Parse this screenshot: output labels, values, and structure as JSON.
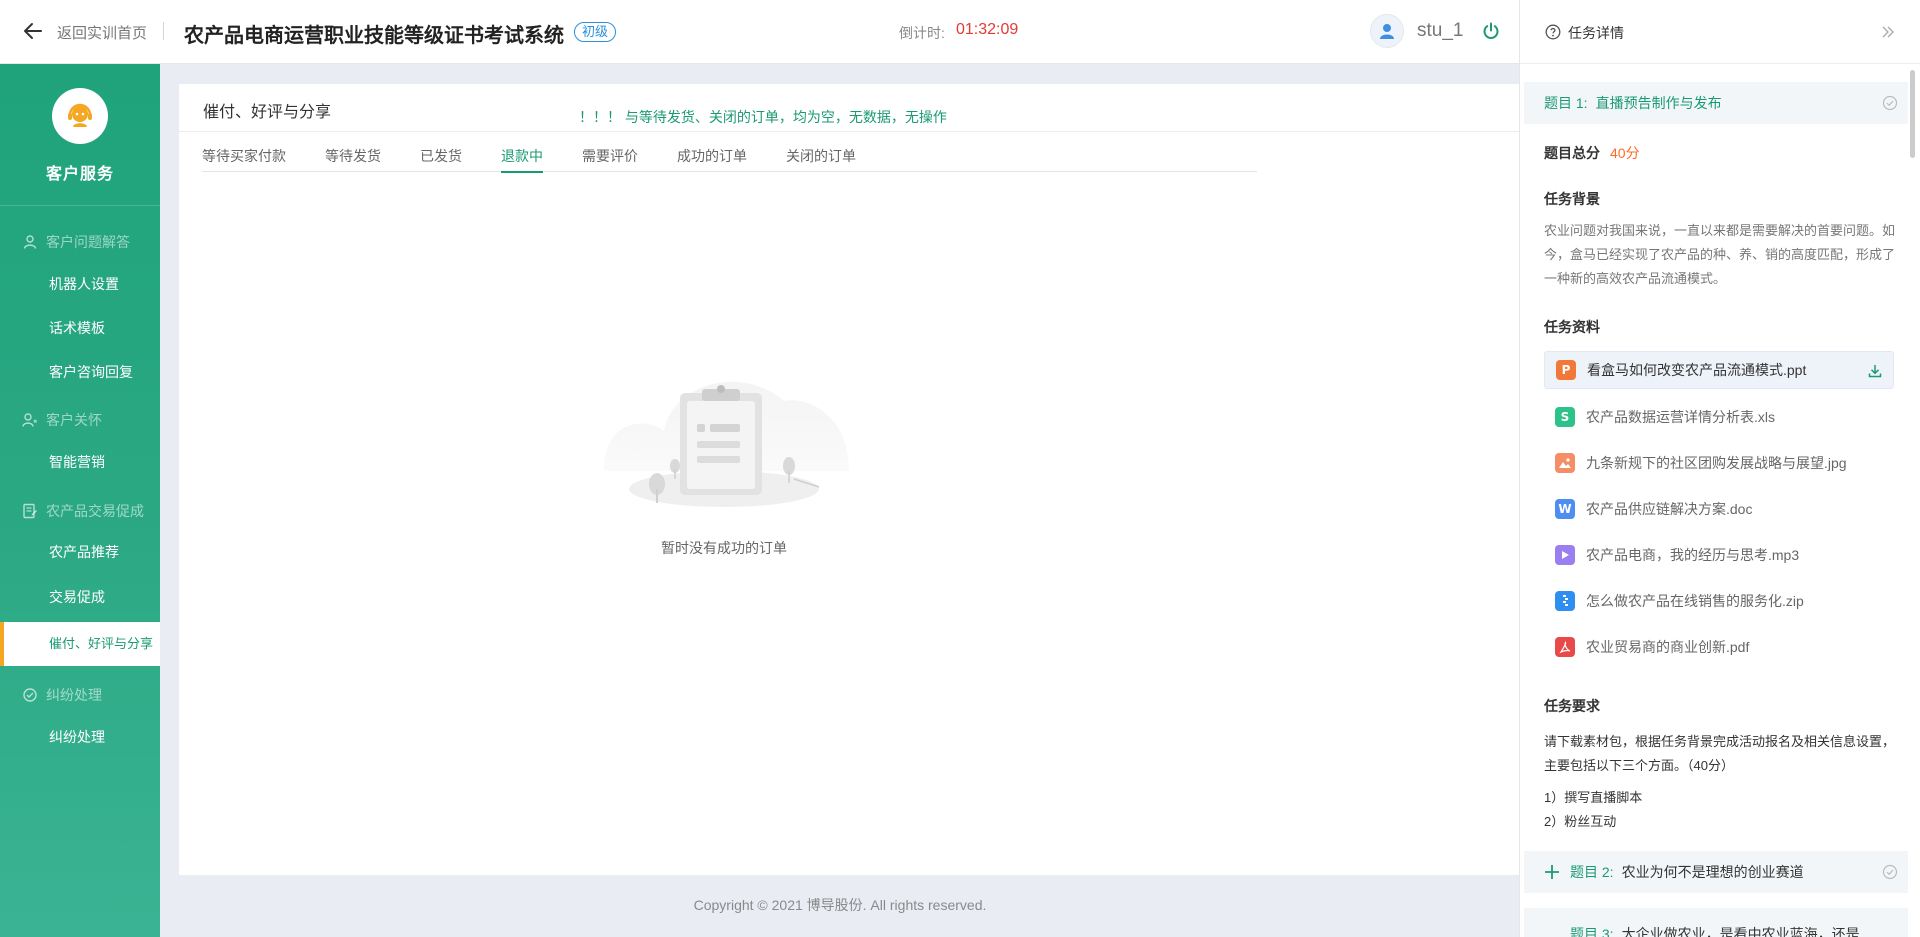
{
  "header": {
    "back_label": "返回实训首页",
    "system_title": "农产品电商运营职业技能等级证书考试系统",
    "level_badge": "初级",
    "countdown_label": "倒计时:",
    "countdown_value": "01:32:09",
    "username": "stu_1"
  },
  "sidebar": {
    "brand_name": "客户服务",
    "groups": [
      {
        "label": "客户问题解答",
        "icon": "user-icon",
        "items": [
          "机器人设置",
          "话术模板",
          "客户咨询回复"
        ]
      },
      {
        "label": "客户关怀",
        "icon": "users-care-icon",
        "items": [
          "智能营销"
        ]
      },
      {
        "label": "农产品交易促成",
        "icon": "document-edit-icon",
        "items": [
          "农产品推荐",
          "交易促成",
          "催付、好评与分享"
        ]
      },
      {
        "label": "纠纷处理",
        "icon": "dispute-icon",
        "items": [
          "纠纷处理"
        ]
      }
    ],
    "active_item": "催付、好评与分享"
  },
  "main": {
    "panel_title": "催付、好评与分享",
    "notice": "！！！ 与等待发货、关闭的订单，均为空，无数据，无操作",
    "tabs": [
      "等待买家付款",
      "等待发货",
      "已发货",
      "退款中",
      "需要评价",
      "成功的订单",
      "关闭的订单"
    ],
    "active_tab": "退款中",
    "empty_text": "暂时没有成功的订单"
  },
  "footer": {
    "copyright": "Copyright © 2021 博导股份. All rights reserved."
  },
  "task_panel": {
    "title": "任务详情",
    "q1": {
      "num": "题目 1:",
      "name": "直播预告制作与发布"
    },
    "score_label": "题目总分",
    "score_value": "40分",
    "background_title": "任务背景",
    "background_text": "农业问题对我国来说，一直以来都是需要解决的首要问题。如今，盒马已经实现了农产品的种、养、销的高度匹配，形成了一种新的高效农产品流通模式。",
    "materials_title": "任务资料",
    "files": [
      {
        "name": "看盒马如何改变农产品流通模式.ppt",
        "type": "ppt",
        "color": "#f0793a"
      },
      {
        "name": "农产品数据运营详情分析表.xls",
        "type": "xls",
        "color": "#2ec28b"
      },
      {
        "name": "九条新规下的社区团购发展战略与展望.jpg",
        "type": "jpg",
        "color": "#f58e66"
      },
      {
        "name": "农产品供应链解决方案.doc",
        "type": "doc",
        "color": "#4d8ff0"
      },
      {
        "name": "农产品电商，我的经历与思考.mp3",
        "type": "mp3",
        "color": "#9b7ef0"
      },
      {
        "name": "怎么做农产品在线销售的服务化.zip",
        "type": "zip",
        "color": "#2f8ff0"
      },
      {
        "name": "农业贸易商的商业创新.pdf",
        "type": "pdf",
        "color": "#e84a4a"
      }
    ],
    "requirements_title": "任务要求",
    "requirements_text": "请下载素材包，根据任务背景完成活动报名及相关信息设置，主要包括以下三个方面。（40分）",
    "requirement_items": [
      "1）撰写直播脚本",
      "2）粉丝互动"
    ],
    "q2": {
      "num": "题目 2:",
      "name": "农业为何不是理想的创业赛道"
    },
    "q3": {
      "num": "题目 3:",
      "name": "大企业做农业，是看中农业蓝海，还是"
    }
  },
  "colors": {
    "brand_green": "#1a9a73",
    "accent_orange": "#f5a623",
    "danger_red": "#e53935",
    "score_orange": "#ff6a2a"
  }
}
